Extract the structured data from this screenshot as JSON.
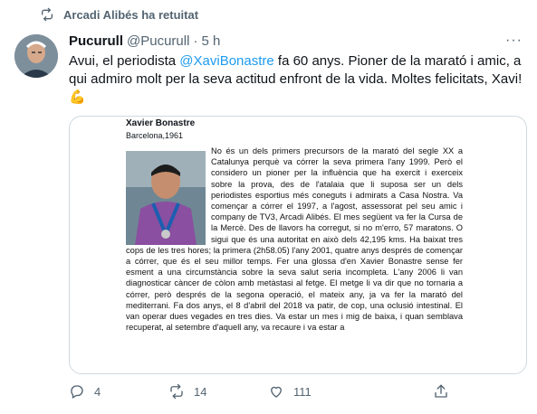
{
  "retweet": {
    "icon": "retweet-icon",
    "text": "Arcadi Alibés ha retuitat"
  },
  "tweet": {
    "author_name": "Pucurull",
    "handle": "@Pucurull",
    "separator": "·",
    "time": "5 h",
    "text_before": "Avui, el periodista ",
    "mention": "@XaviBonastre",
    "text_after": " fa 60 anys. Pioner de la marató i amic, a qui admiro molt per la seva actitud enfront de la vida. Moltes felicitats, Xavi! ",
    "emoji": "💪",
    "more_icon": "···"
  },
  "image_doc": {
    "name": "Xavier Bonastre",
    "place": "Barcelona,1961",
    "body": "No és un dels primers precursors de la marató del segle XX a Catalunya perquè va córrer la seva primera l'any 1999. Però el considero un pioner per la influència que ha exercit i exerceix sobre la prova, des de l'atalaia que li suposa ser un dels periodistes esportius més coneguts i admirats a Casa Nostra. Va començar a córrer el 1997, a l'agost, assessorat pel seu amic i company de TV3, Arcadi Alibés. El mes següent va fer la Cursa de la Mercè. Des de llavors ha corregut, si no m'erro, 57 maratons. O sigui que és una autoritat en això dels 42,195 kms. Ha baixat tres cops de les tres hores; la primera (2h58.05) l'any 2001, quatre anys després de començar a córrer, que és el seu millor temps. Fer una glossa d'en Xavier Bonastre sense fer esment a una circumstància sobre la seva salut seria incompleta. L'any 2006 li van diagnosticar càncer de còlon amb metàstasi al fetge. El metge li va dir que no tornaria a córrer, però després de la segona operació, el mateix any, ja va fer la marató del mediterrani. Fa dos anys, el 8 d'abril del 2018 va patir, de cop, una oclusió intestinal. El van operar dues vegades en tres dies. Va estar un mes i mig de baixa, i quan semblava recuperat, al setembre d'aquell any, va recaure i va estar a"
  },
  "actions": {
    "reply_count": "4",
    "retweet_count": "14",
    "like_count": "111"
  },
  "colors": {
    "accent": "#1d9bf0",
    "muted": "#536471",
    "text": "#0f1419",
    "border": "#cfd9de"
  }
}
